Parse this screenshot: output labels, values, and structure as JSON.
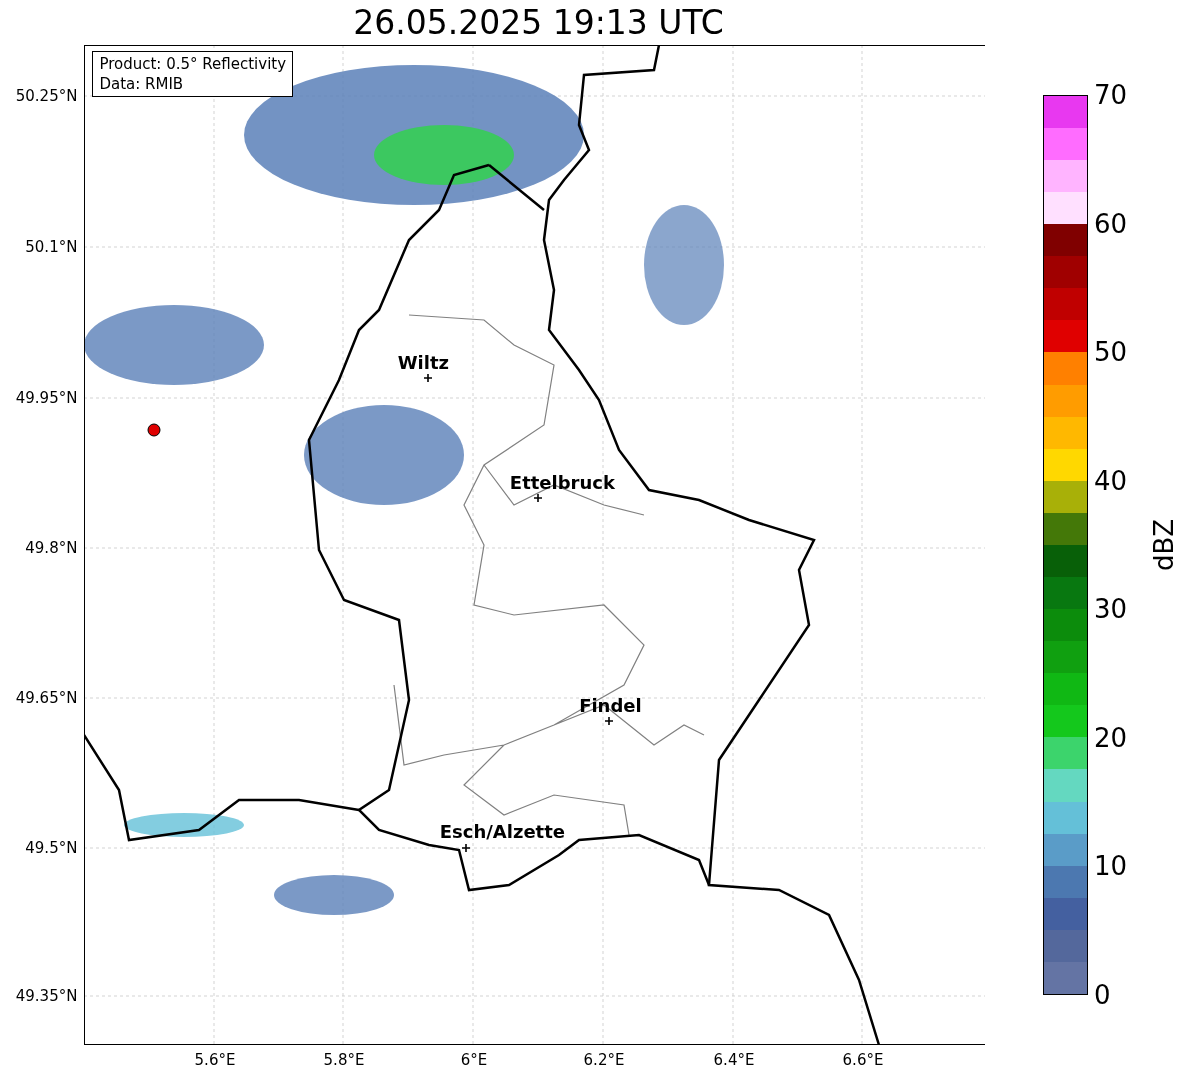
{
  "title": "26.05.2025 19:13 UTC",
  "info_box": {
    "lines": [
      "Product: 0.5° Reflectivity",
      "Data: RMIB"
    ]
  },
  "map": {
    "y_ticks": [
      "50.25°N",
      "50.1°N",
      "49.95°N",
      "49.8°N",
      "49.65°N",
      "49.5°N",
      "49.35°N"
    ],
    "x_ticks": [
      "5.6°E",
      "5.8°E",
      "6°E",
      "6.2°E",
      "6.4°E",
      "6.6°E"
    ],
    "places": [
      {
        "name": "Wiltz"
      },
      {
        "name": "Ettelbruck"
      },
      {
        "name": "Findel"
      },
      {
        "name": "Esch/Alzette"
      }
    ]
  },
  "colorbar": {
    "label": "dBZ",
    "ticks": [
      "70",
      "60",
      "50",
      "40",
      "30",
      "20",
      "10",
      "0"
    ],
    "segments": [
      {
        "color": "#6474a4"
      },
      {
        "color": "#54689c"
      },
      {
        "color": "#4460a0"
      },
      {
        "color": "#4c78b0"
      },
      {
        "color": "#5a9cc8"
      },
      {
        "color": "#64c0d8"
      },
      {
        "color": "#64d8c0"
      },
      {
        "color": "#3cd46c"
      },
      {
        "color": "#14c81c"
      },
      {
        "color": "#10b814"
      },
      {
        "color": "#10a010"
      },
      {
        "color": "#0c8c0c"
      },
      {
        "color": "#087810"
      },
      {
        "color": "#086008"
      },
      {
        "color": "#447808"
      },
      {
        "color": "#a8b008"
      },
      {
        "color": "#ffd800"
      },
      {
        "color": "#ffb800"
      },
      {
        "color": "#ff9c00"
      },
      {
        "color": "#ff8000"
      },
      {
        "color": "#e00000"
      },
      {
        "color": "#c00000"
      },
      {
        "color": "#a00000"
      },
      {
        "color": "#800000"
      },
      {
        "color": "#ffe0ff"
      },
      {
        "color": "#ffb4ff"
      },
      {
        "color": "#ff6cff"
      },
      {
        "color": "#e838f0"
      }
    ]
  }
}
